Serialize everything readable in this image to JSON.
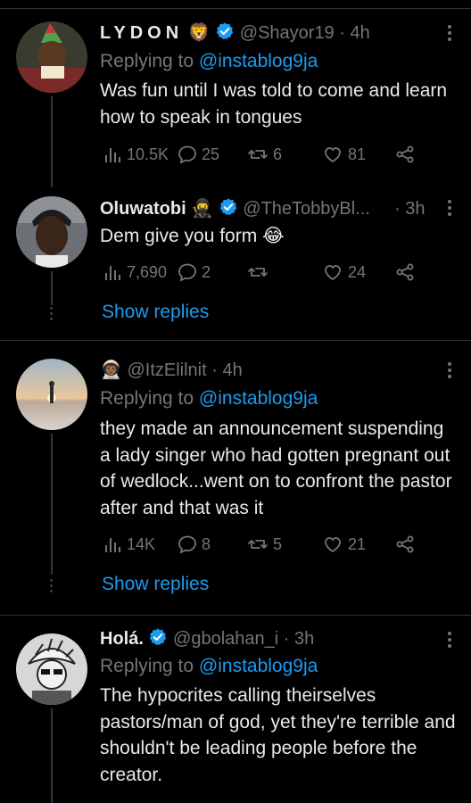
{
  "colors": {
    "accent": "#1d9bf0",
    "muted": "#71767b",
    "text": "#e7e9ea",
    "background": "#000000"
  },
  "tweets": [
    {
      "name": "LYDON",
      "name_emoji": "🦁",
      "verified": true,
      "handle": "@Shayor19",
      "time": "· 4h",
      "replying_label": "Replying to",
      "replying_to": "@instablog9ja",
      "text": "Was fun until I was told to come and learn how to speak in tongues",
      "stats": {
        "views": "10.5K",
        "replies": "25",
        "retweets": "6",
        "likes": "81"
      }
    },
    {
      "name": "Oluwatobi",
      "name_emoji": "🥷",
      "verified": true,
      "handle": "@TheTobbyBl...",
      "time": "· 3h",
      "text": "Dem give you form 😂",
      "stats": {
        "views": "7,690",
        "replies": "2",
        "retweets": "",
        "likes": "24"
      }
    },
    {
      "name_emoji": "👨🏾‍🚀",
      "verified": false,
      "handle": "@ItzElilnit",
      "time": "· 4h",
      "replying_label": "Replying to",
      "replying_to": "@instablog9ja",
      "text": "they made an announcement suspending a lady singer who had gotten pregnant out of wedlock...went on to confront the pastor after and that was it",
      "stats": {
        "views": "14K",
        "replies": "8",
        "retweets": "5",
        "likes": "21"
      }
    },
    {
      "name": "Holá.",
      "verified": true,
      "handle": "@gbolahan_i",
      "time": "· 3h",
      "replying_label": "Replying to",
      "replying_to": "@instablog9ja",
      "text": "The hypocrites calling theirselves pastors/man of god, yet they're terrible and shouldn't be leading people before the creator."
    }
  ],
  "show_replies": "Show replies",
  "icons": [
    "views-icon",
    "reply-icon",
    "retweet-icon",
    "like-icon",
    "share-icon",
    "verified-badge-icon",
    "more-icon"
  ]
}
